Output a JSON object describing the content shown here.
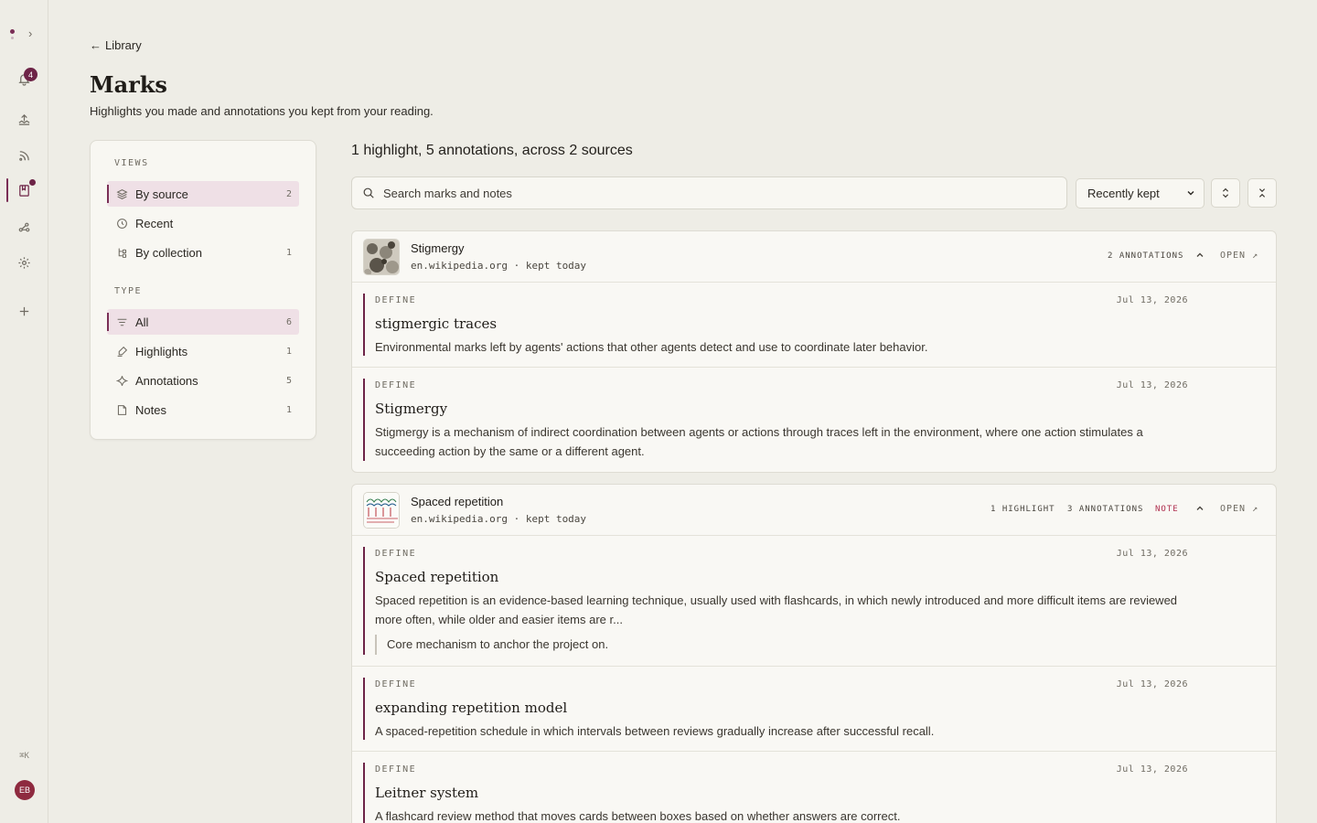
{
  "rail": {
    "notification_count": "4",
    "shortcut_hint": "⌘K",
    "user_initials": "EB",
    "icons": [
      "chevron-right-icon",
      "bell-icon",
      "upload-icon",
      "rss-icon",
      "bookmark-book-icon",
      "graph-icon",
      "gear-icon",
      "plus-icon"
    ]
  },
  "header": {
    "back_label": "Library",
    "title": "Marks",
    "subtitle": "Highlights you made and annotations you kept from your reading."
  },
  "sidebar": {
    "views_label": "VIEWS",
    "views": [
      {
        "label": "By source",
        "count": "2",
        "icon": "layers-icon",
        "active": true
      },
      {
        "label": "Recent",
        "count": "",
        "icon": "clock-icon",
        "active": false
      },
      {
        "label": "By collection",
        "count": "1",
        "icon": "tree-icon",
        "active": false
      }
    ],
    "type_label": "TYPE",
    "types": [
      {
        "label": "All",
        "count": "6",
        "icon": "filter-icon",
        "active": true
      },
      {
        "label": "Highlights",
        "count": "1",
        "icon": "highlighter-icon",
        "active": false
      },
      {
        "label": "Annotations",
        "count": "5",
        "icon": "sparkle-icon",
        "active": false
      },
      {
        "label": "Notes",
        "count": "1",
        "icon": "note-icon",
        "active": false
      }
    ]
  },
  "main": {
    "summary": "1 highlight, 5 annotations, across 2 sources",
    "search_placeholder": "Search marks and notes",
    "sort_value": "Recently kept",
    "sort_options": [
      "Recently kept"
    ]
  },
  "sources": [
    {
      "title": "Stigmergy",
      "meta": "en.wikipedia.org · kept today",
      "chips": [
        "2 ANNOTATIONS"
      ],
      "open_label": "OPEN ↗",
      "entries": [
        {
          "kind": "DEFINE",
          "date": "Jul 13, 2026",
          "term": "stigmergic traces",
          "definition": "Environmental marks left by agents' actions that other agents detect and use to coordinate later behavior."
        },
        {
          "kind": "DEFINE",
          "date": "Jul 13, 2026",
          "term": "Stigmergy",
          "definition": "Stigmergy is a mechanism of indirect coordination between agents or actions through traces left in the environment, where one action stimulates a succeeding action by the same or a different agent."
        }
      ]
    },
    {
      "title": "Spaced repetition",
      "meta": "en.wikipedia.org · kept today",
      "chips": [
        "1 HIGHLIGHT",
        "3 ANNOTATIONS",
        "NOTE"
      ],
      "open_label": "OPEN ↗",
      "entries": [
        {
          "kind": "DEFINE",
          "date": "Jul 13, 2026",
          "term": "Spaced repetition",
          "definition": "Spaced repetition is an evidence-based learning technique, usually used with flashcards, in which newly introduced and more difficult items are reviewed more often, while older and easier items are r...",
          "note": "Core mechanism to anchor the project on."
        },
        {
          "kind": "DEFINE",
          "date": "Jul 13, 2026",
          "term": "expanding repetition model",
          "definition": "A spaced-repetition schedule in which intervals between reviews gradually increase after successful recall."
        },
        {
          "kind": "DEFINE",
          "date": "Jul 13, 2026",
          "term": "Leitner system",
          "definition": "A flashcard review method that moves cards between boxes based on whether answers are correct."
        }
      ]
    }
  ],
  "colors": {
    "accent": "#6d2447",
    "background": "#eeede6",
    "surface": "#f8f7f2",
    "note_chip": "#b0304f"
  }
}
